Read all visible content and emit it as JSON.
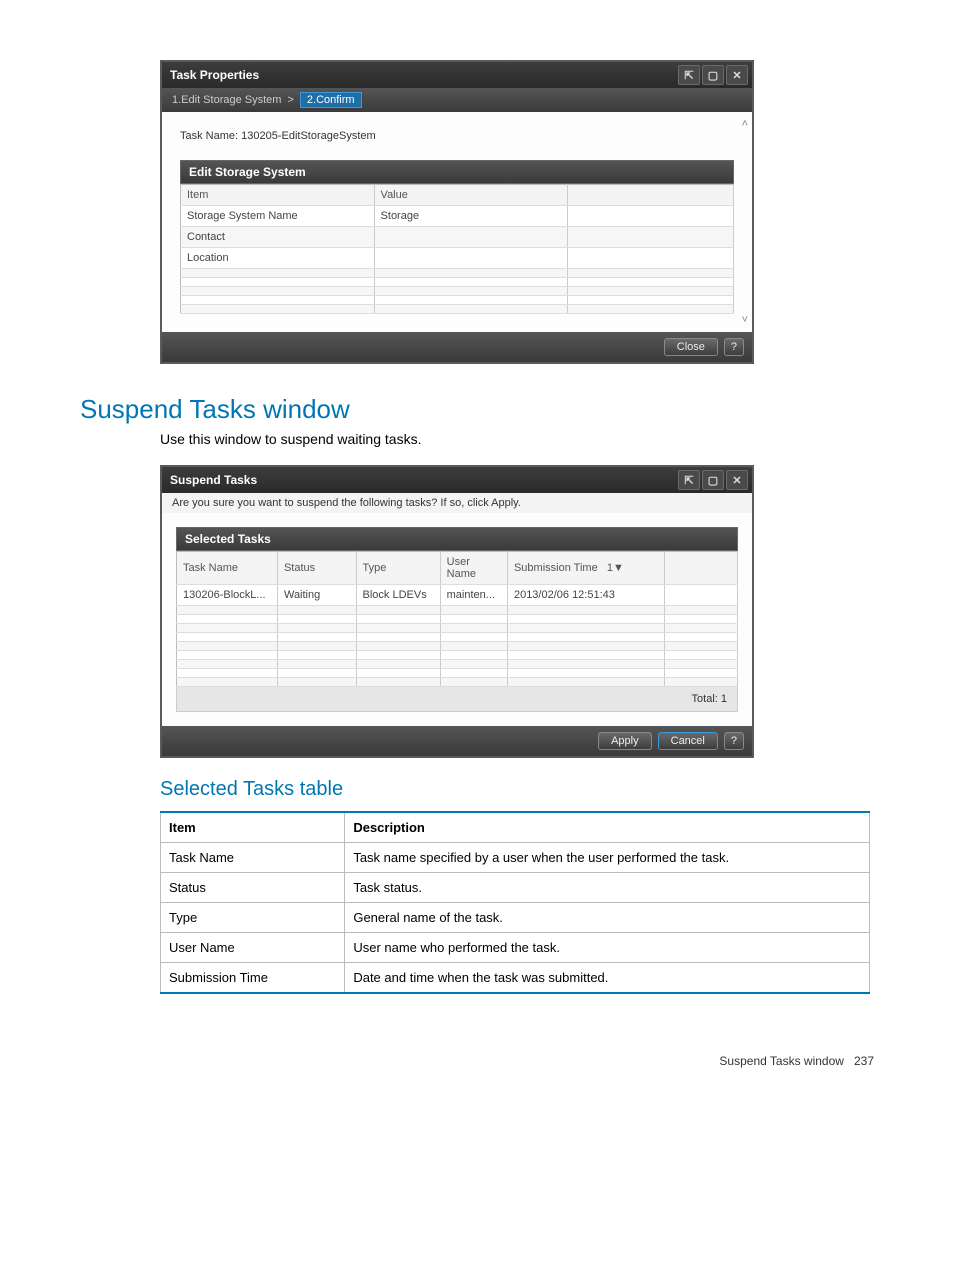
{
  "window1": {
    "title": "Task Properties",
    "crumbs": {
      "step1": "1.Edit Storage System",
      "sep": ">",
      "step2": "2.Confirm"
    },
    "task_name_line": "Task Name: 130205-EditStorageSystem",
    "section_title": "Edit Storage System",
    "headers": {
      "item": "Item",
      "value": "Value"
    },
    "rows": [
      {
        "item": "Storage System Name",
        "value": "Storage"
      },
      {
        "item": "Contact",
        "value": ""
      },
      {
        "item": "Location",
        "value": ""
      },
      {
        "item": "",
        "value": ""
      },
      {
        "item": "",
        "value": ""
      },
      {
        "item": "",
        "value": ""
      },
      {
        "item": "",
        "value": ""
      },
      {
        "item": "",
        "value": ""
      }
    ],
    "close_label": "Close",
    "help_label": "?"
  },
  "doc": {
    "heading": "Suspend Tasks window",
    "intro": "Use this window to suspend waiting tasks.",
    "subheading": "Selected Tasks table"
  },
  "window2": {
    "title": "Suspend Tasks",
    "message": "Are you sure you want to suspend the following tasks? If so, click Apply.",
    "section_title": "Selected Tasks",
    "headers": {
      "task_name": "Task Name",
      "status": "Status",
      "type": "Type",
      "user_name": "User Name",
      "submission_time": "Submission Time",
      "sort_indicator": "1▼"
    },
    "rows": [
      {
        "task_name": "130206-BlockL...",
        "status": "Waiting",
        "type": "Block LDEVs",
        "user_name": "mainten...",
        "submission_time": "2013/02/06 12:51:43"
      },
      {
        "task_name": "",
        "status": "",
        "type": "",
        "user_name": "",
        "submission_time": ""
      },
      {
        "task_name": "",
        "status": "",
        "type": "",
        "user_name": "",
        "submission_time": ""
      },
      {
        "task_name": "",
        "status": "",
        "type": "",
        "user_name": "",
        "submission_time": ""
      },
      {
        "task_name": "",
        "status": "",
        "type": "",
        "user_name": "",
        "submission_time": ""
      },
      {
        "task_name": "",
        "status": "",
        "type": "",
        "user_name": "",
        "submission_time": ""
      },
      {
        "task_name": "",
        "status": "",
        "type": "",
        "user_name": "",
        "submission_time": ""
      },
      {
        "task_name": "",
        "status": "",
        "type": "",
        "user_name": "",
        "submission_time": ""
      },
      {
        "task_name": "",
        "status": "",
        "type": "",
        "user_name": "",
        "submission_time": ""
      },
      {
        "task_name": "",
        "status": "",
        "type": "",
        "user_name": "",
        "submission_time": ""
      }
    ],
    "total_label": "Total: 1",
    "apply_label": "Apply",
    "cancel_label": "Cancel",
    "help_label": "?"
  },
  "desc_table": {
    "headers": {
      "item": "Item",
      "description": "Description"
    },
    "rows": [
      {
        "item": "Task Name",
        "description": "Task name specified by a user when the user performed the task."
      },
      {
        "item": "Status",
        "description": "Task status."
      },
      {
        "item": "Type",
        "description": "General name of the task."
      },
      {
        "item": "User Name",
        "description": "User name who performed the task."
      },
      {
        "item": "Submission Time",
        "description": "Date and time when the task was submitted."
      }
    ]
  },
  "footer": {
    "text": "Suspend Tasks window",
    "page": "237"
  }
}
